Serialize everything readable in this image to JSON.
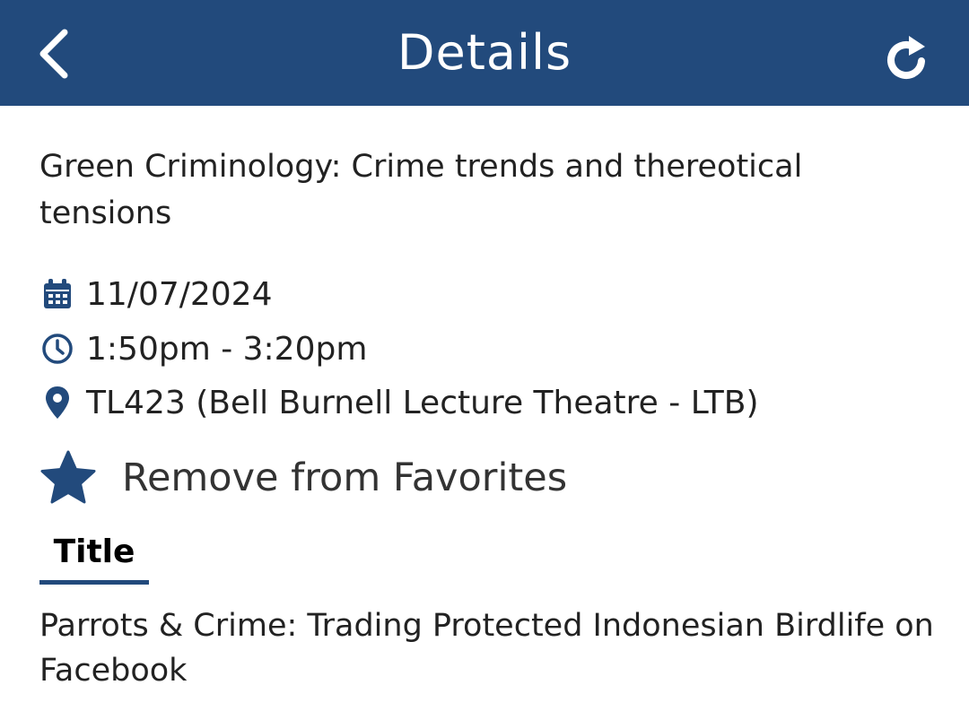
{
  "header": {
    "title": "Details",
    "back_icon": "chevron-left-icon",
    "refresh_icon": "refresh-icon",
    "background": "#224a7c"
  },
  "session": {
    "title": "Green Criminology: Crime trends and thereotical tensions",
    "date": "11/07/2024",
    "time": "1:50pm - 3:20pm",
    "location": "TL423 (Bell Burnell Lecture Theatre - LTB)"
  },
  "favorites": {
    "label": "Remove from Favorites",
    "icon": "star-icon",
    "is_favorite": true
  },
  "tabs": [
    {
      "label": "Title",
      "active": true
    }
  ],
  "talk": {
    "title": "Parrots & Crime: Trading Protected Indonesian Birdlife on Facebook"
  },
  "colors": {
    "accent": "#224a7c",
    "text": "#222222"
  }
}
